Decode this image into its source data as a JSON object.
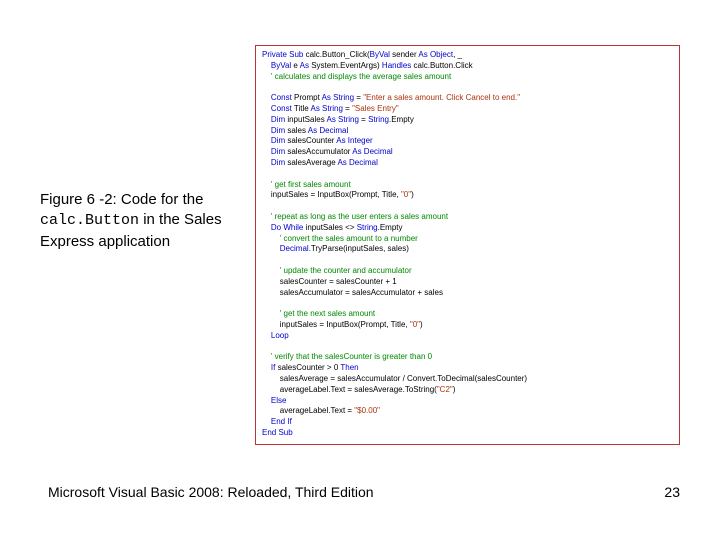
{
  "caption": {
    "prefix": "Figure 6 -2: Code for the ",
    "mono": "calc.Button",
    "suffix": " in the Sales Express application"
  },
  "code": {
    "l01a": "Private Sub",
    "l01b": " calc.Button_Click(",
    "l01c": "ByVal",
    "l01d": " sender ",
    "l01e": "As Object",
    "l01f": ", _",
    "l02a": "    ",
    "l02b": "ByVal",
    "l02c": " e ",
    "l02d": "As",
    "l02e": " System.EventArgs) ",
    "l02f": "Handles",
    "l02g": " calc.Button.Click",
    "l03": "    ' calculates and displays the average sales amount",
    "l05a": "    ",
    "l05b": "Const",
    "l05c": " Prompt ",
    "l05d": "As String",
    "l05e": " = ",
    "l05f": "\"Enter a sales amount. Click Cancel to end.\"",
    "l06a": "    ",
    "l06b": "Const",
    "l06c": " Title ",
    "l06d": "As String",
    "l06e": " = ",
    "l06f": "\"Sales Entry\"",
    "l07a": "    ",
    "l07b": "Dim",
    "l07c": " inputSales ",
    "l07d": "As String",
    "l07e": " = ",
    "l07f": "String",
    "l07g": ".Empty",
    "l08a": "    ",
    "l08b": "Dim",
    "l08c": " sales ",
    "l08d": "As Decimal",
    "l09a": "    ",
    "l09b": "Dim",
    "l09c": " salesCounter ",
    "l09d": "As Integer",
    "l10a": "    ",
    "l10b": "Dim",
    "l10c": " salesAccumulator ",
    "l10d": "As Decimal",
    "l11a": "    ",
    "l11b": "Dim",
    "l11c": " salesAverage ",
    "l11d": "As Decimal",
    "l13": "    ' get first sales amount",
    "l14a": "    inputSales = InputBox(Prompt, Title, ",
    "l14b": "\"0\"",
    "l14c": ")",
    "l16": "    ' repeat as long as the user enters a sales amount",
    "l17a": "    ",
    "l17b": "Do While",
    "l17c": " inputSales <> ",
    "l17d": "String",
    "l17e": ".Empty",
    "l18": "        ' convert the sales amount to a number",
    "l19a": "        ",
    "l19b": "Decimal",
    "l19c": ".TryParse(inputSales, sales)",
    "l21": "        ' update the counter and accumulator",
    "l22": "        salesCounter = salesCounter + 1",
    "l23": "        salesAccumulator = salesAccumulator + sales",
    "l25": "        ' get the next sales amount",
    "l26a": "        inputSales = InputBox(Prompt, Title, ",
    "l26b": "\"0\"",
    "l26c": ")",
    "l27": "    Loop",
    "l29": "    ' verify that the salesCounter is greater than 0",
    "l30a": "    ",
    "l30b": "If",
    "l30c": " salesCounter > 0 ",
    "l30d": "Then",
    "l31": "        salesAverage = salesAccumulator / Convert.ToDecimal(salesCounter)",
    "l32a": "        averageLabel.Text = salesAverage.ToString(",
    "l32b": "\"C2\"",
    "l32c": ")",
    "l33": "    Else",
    "l34a": "        averageLabel.Text = ",
    "l34b": "\"$0.00\"",
    "l35": "    End If",
    "l36": "End Sub"
  },
  "footer": {
    "left": "Microsoft Visual Basic 2008: Reloaded, Third Edition",
    "right": "23"
  }
}
